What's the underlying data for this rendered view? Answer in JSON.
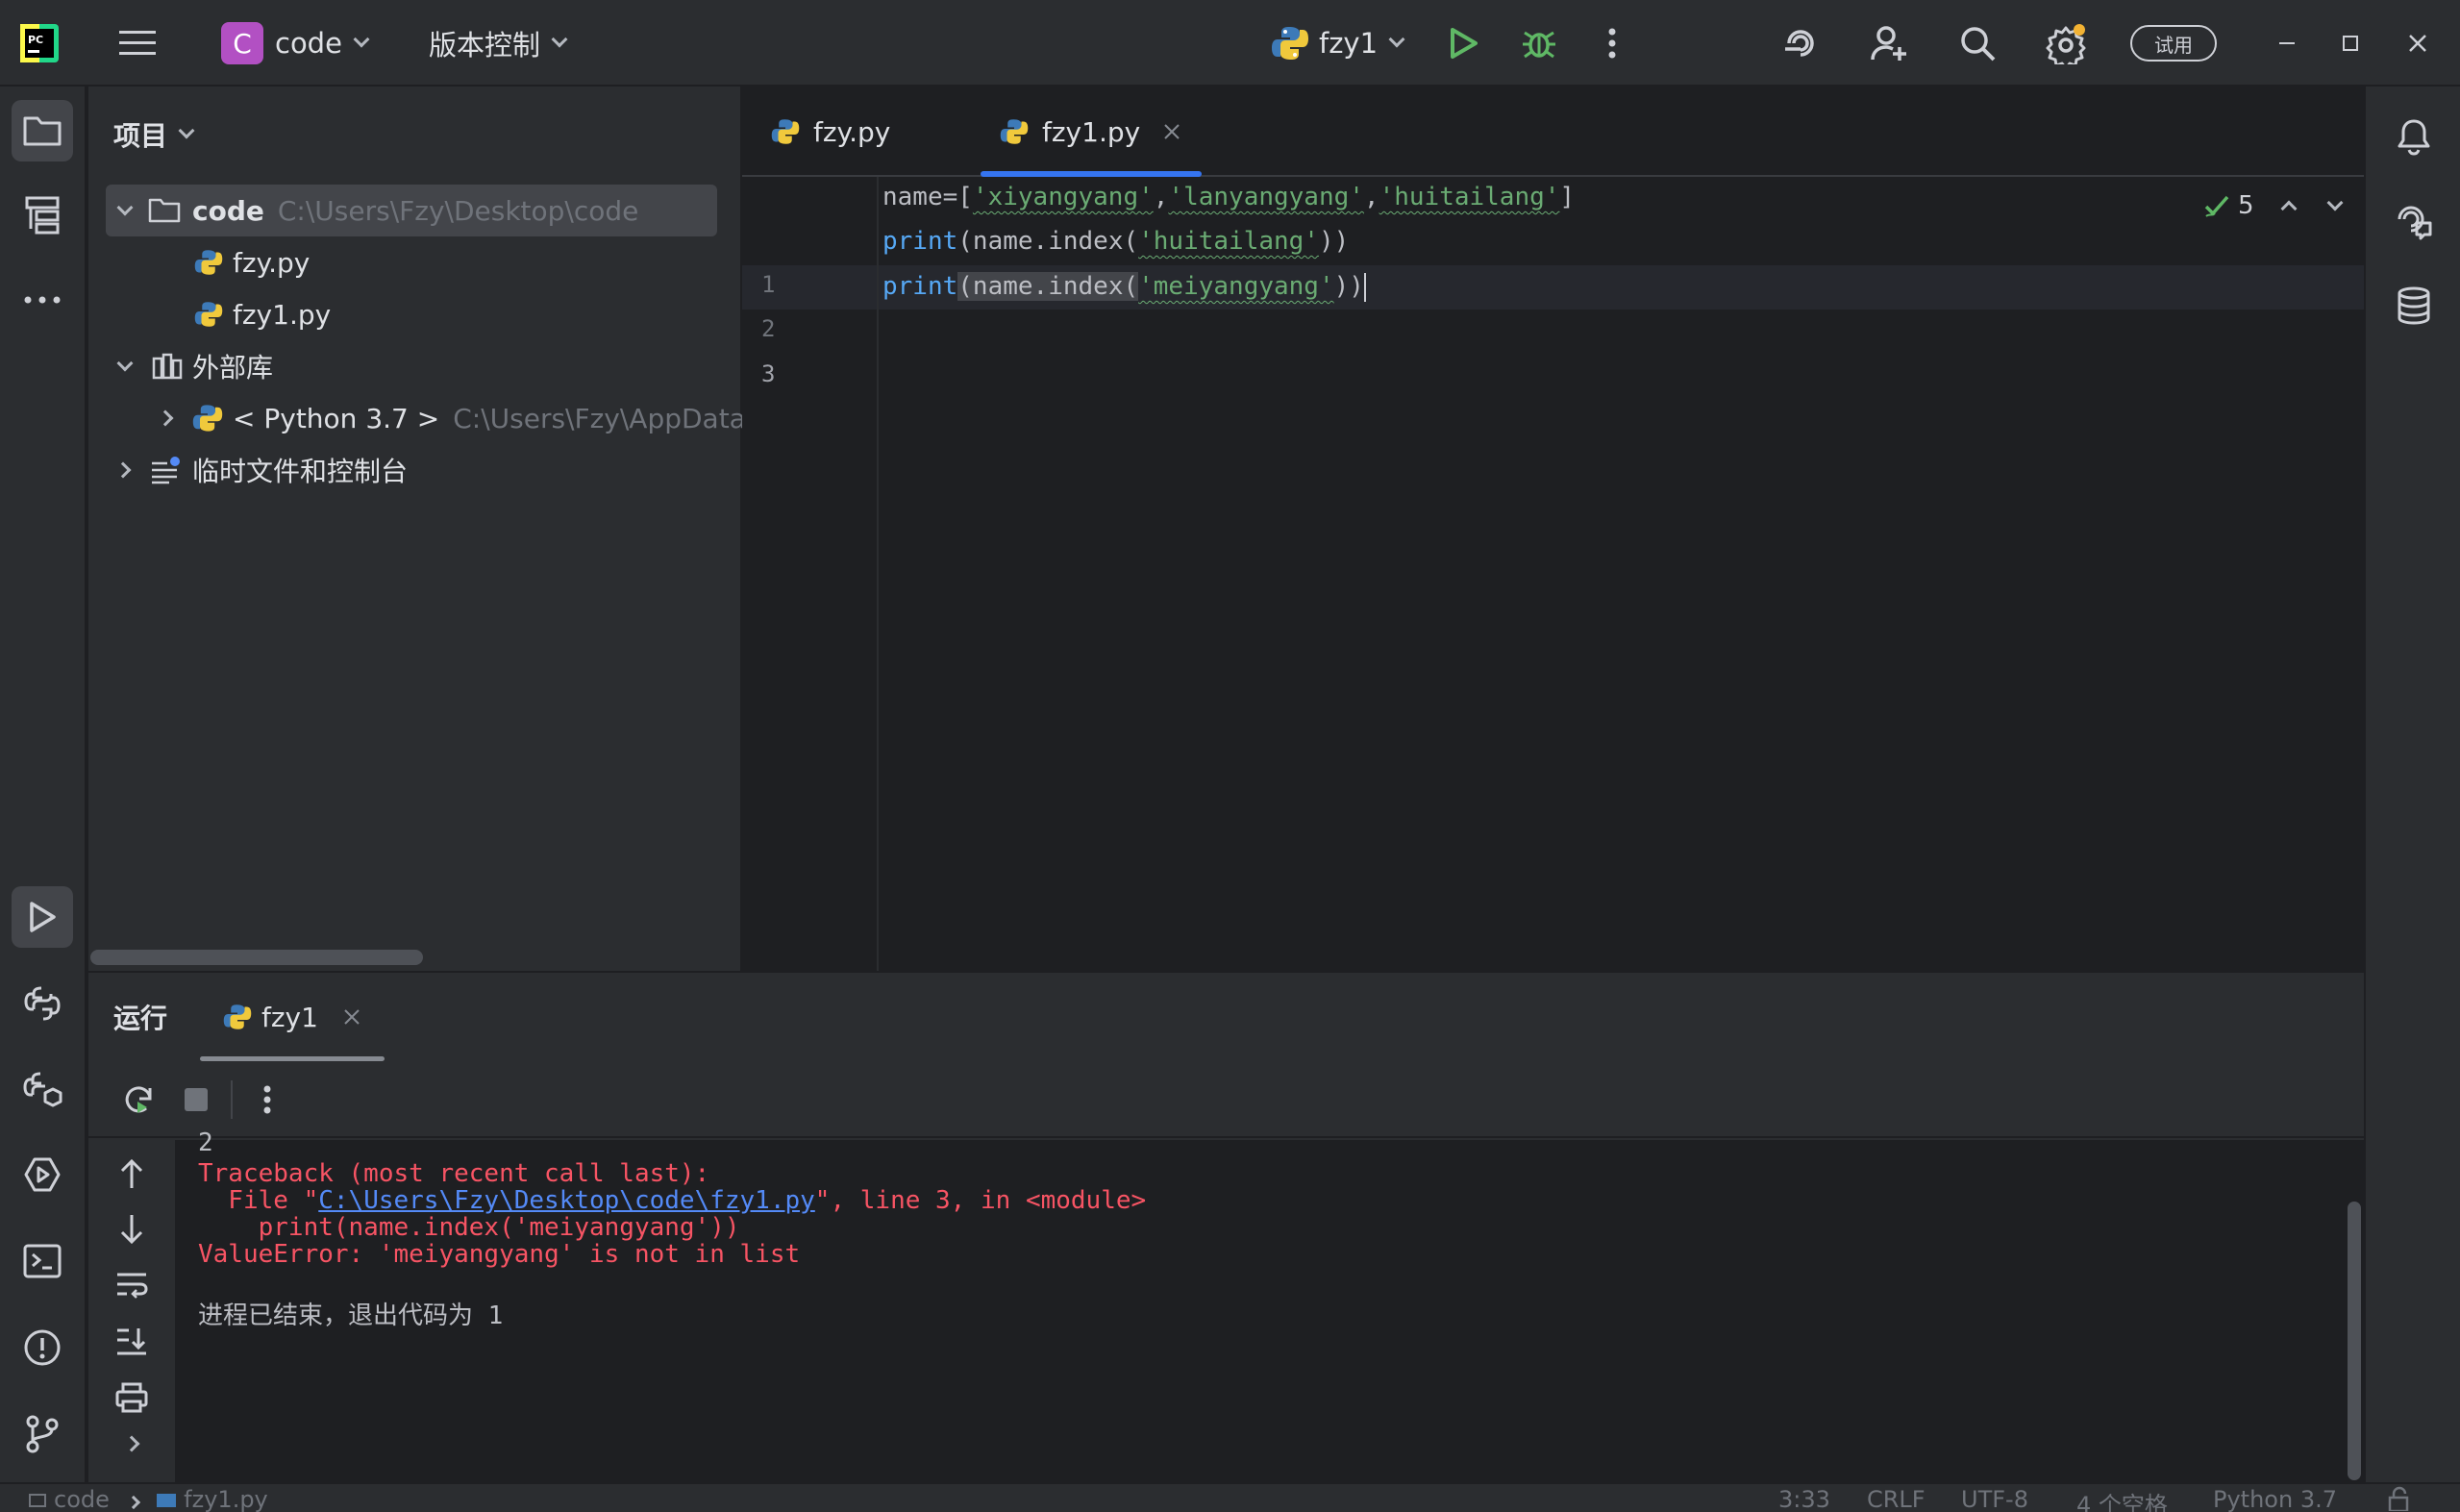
{
  "titlebar": {
    "project_badge": "C",
    "project_name": "code",
    "vcs_menu": "版本控制",
    "run_config": "fzy1",
    "trial_label": "试用"
  },
  "project_panel": {
    "title": "项目",
    "root": {
      "name": "code",
      "path": "C:\\Users\\Fzy\\Desktop\\code"
    },
    "files": [
      "fzy.py",
      "fzy1.py"
    ],
    "external_libs": "外部库",
    "python_sdk": {
      "name": "< Python 3.7 >",
      "path": "C:\\Users\\Fzy\\AppData\\Lo"
    },
    "scratches": "临时文件和控制台"
  },
  "editor": {
    "tabs": [
      {
        "label": "fzy.py",
        "active": false
      },
      {
        "label": "fzy1.py",
        "active": true
      }
    ],
    "inspection_count": "5",
    "lines": [
      {
        "num": "1",
        "text": "name=['xiyangyang','lanyangyang','huitailang']"
      },
      {
        "num": "2",
        "text": "print(name.index('huitailang'))"
      },
      {
        "num": "3",
        "text": "print(name.index('meiyangyang'))"
      }
    ],
    "tokens": {
      "l1_pre": "name=[",
      "l1_s1": "'xiyangyang'",
      "l1_s2": "'lanyangyang'",
      "l1_s3": "'huitailang'",
      "l2_s": "'huitailang'",
      "l3_s": "'meiyangyang'",
      "print": "print",
      "call_open": "(name.index(",
      "call_close": "))",
      "comma": ",",
      "close_bracket": "]"
    }
  },
  "run_panel": {
    "title": "运行",
    "tab_label": "fzy1",
    "output": {
      "prev_value": "2",
      "traceback_header": "Traceback (most recent call last):",
      "file_prefix": "  File \"",
      "file_link": "C:\\Users\\Fzy\\Desktop\\code\\fzy1.py",
      "file_suffix": "\", line 3, in <module>",
      "code_line": "    print(name.index('meiyangyang'))",
      "error": "ValueError: 'meiyangyang' is not in list",
      "exit_msg": "进程已结束，退出代码为 1"
    }
  },
  "statusbar": {
    "crumb_project": "code",
    "crumb_file": "fzy1.py",
    "position": "3:33",
    "line_sep": "CRLF",
    "encoding": "UTF-8",
    "indent": "4 个空格",
    "interpreter": "Python 3.7"
  },
  "colors": {
    "background": "#1e1f22",
    "panel": "#2b2d30",
    "accent": "#3574f0",
    "string": "#6aab73",
    "keyword": "#56a8f5",
    "error": "#f75464",
    "run_green": "#5fb865"
  }
}
